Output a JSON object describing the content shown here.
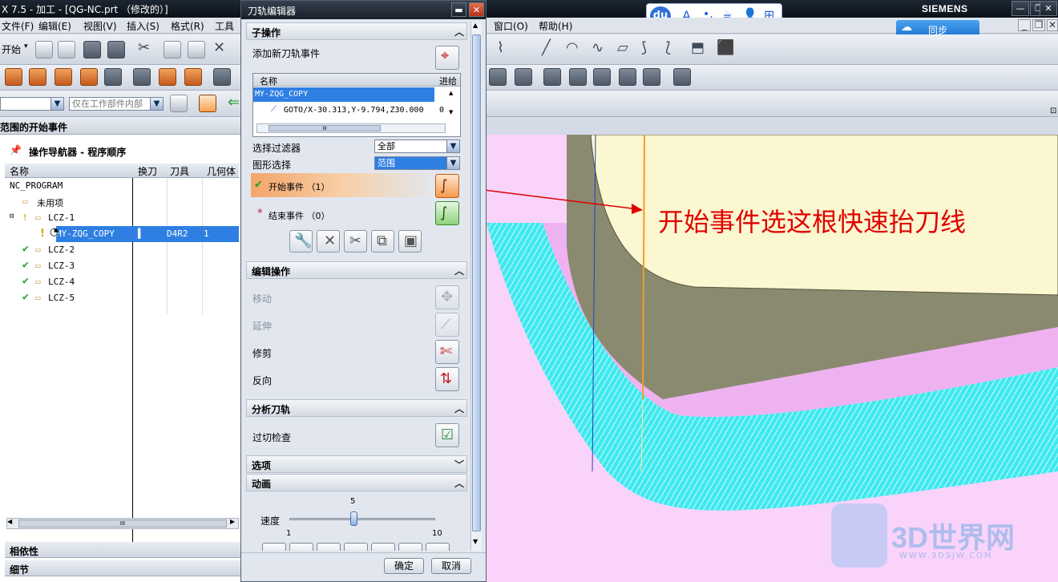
{
  "app": {
    "title": "X 7.5 - 加工 - [QG-NC.prt （修改的）]",
    "brand": "SIEMENS",
    "menus": [
      "文件(F)",
      "编辑(E)",
      "视图(V)",
      "插入(S)",
      "格式(R)",
      "工具"
    ],
    "menus_right": [
      "窗口(O)",
      "帮助(H)"
    ],
    "start_label": "开始",
    "filter_placeholder": "仅在工作部件内部",
    "range_header": "范围的开始事件",
    "sogou": {
      "logo": "du",
      "items": [
        "A",
        "•,",
        "☕",
        "👤",
        "⊞"
      ]
    },
    "cloud_button": "同步"
  },
  "navigator": {
    "title": "操作导航器 - 程序顺序",
    "columns": [
      "名称",
      "换刀",
      "刀具",
      "几何体"
    ],
    "rows": [
      {
        "name": "NC_PROGRAM",
        "indent": 0,
        "tool": "",
        "geom": ""
      },
      {
        "name": "未用项",
        "indent": 1,
        "tool": "",
        "geom": ""
      },
      {
        "name": "LCZ-1",
        "indent": 1,
        "tool": "",
        "geom": ""
      },
      {
        "name": "MY-ZQG_COPY",
        "indent": 2,
        "tool": "D4R2",
        "geom": "1",
        "selected": true
      },
      {
        "name": "LCZ-2",
        "indent": 1,
        "tool": "",
        "geom": ""
      },
      {
        "name": "LCZ-3",
        "indent": 1,
        "tool": "",
        "geom": ""
      },
      {
        "name": "LCZ-4",
        "indent": 1,
        "tool": "",
        "geom": ""
      },
      {
        "name": "LCZ-5",
        "indent": 1,
        "tool": "",
        "geom": ""
      }
    ],
    "scroll_mark": "III",
    "panels": [
      "相依性",
      "细节"
    ]
  },
  "dialog": {
    "title": "刀轨编辑器",
    "sub_ops": {
      "header": "子操作",
      "add_event": "添加新刀轨事件",
      "list_columns": [
        "名称",
        "进给"
      ],
      "list_rows": [
        {
          "name": "MY-ZQG_COPY",
          "feed": ""
        },
        {
          "name": "GOTO/X-30.313,Y-9.794,Z30.000",
          "feed": "0"
        }
      ],
      "scroll_mark": "III",
      "filter_label": "选择过滤器",
      "filter_value": "全部",
      "graphic_label": "图形选择",
      "graphic_value": "范围",
      "start_event": "开始事件 （1）",
      "end_event": "结束事件 （0）"
    },
    "edit_ops": {
      "header": "编辑操作",
      "items": [
        {
          "label": "移动",
          "enabled": false
        },
        {
          "label": "延伸",
          "enabled": false
        },
        {
          "label": "修剪",
          "enabled": true
        },
        {
          "label": "反向",
          "enabled": true
        }
      ]
    },
    "analyze": {
      "header": "分析刀轨",
      "gouge_check": "过切检查"
    },
    "options": {
      "header": "选项"
    },
    "animation": {
      "header": "动画",
      "speed_label": "速度",
      "speed_value": 5,
      "speed_min": "1",
      "speed_max": "10",
      "speed_value_text": "5"
    },
    "ok": "确定",
    "cancel": "取消"
  },
  "annotation": {
    "text": "开始事件选这根快速抬刀线",
    "color": "#e00000"
  },
  "watermark": {
    "text": "3D世界网",
    "url": "WWW.3DSJW.COM"
  }
}
